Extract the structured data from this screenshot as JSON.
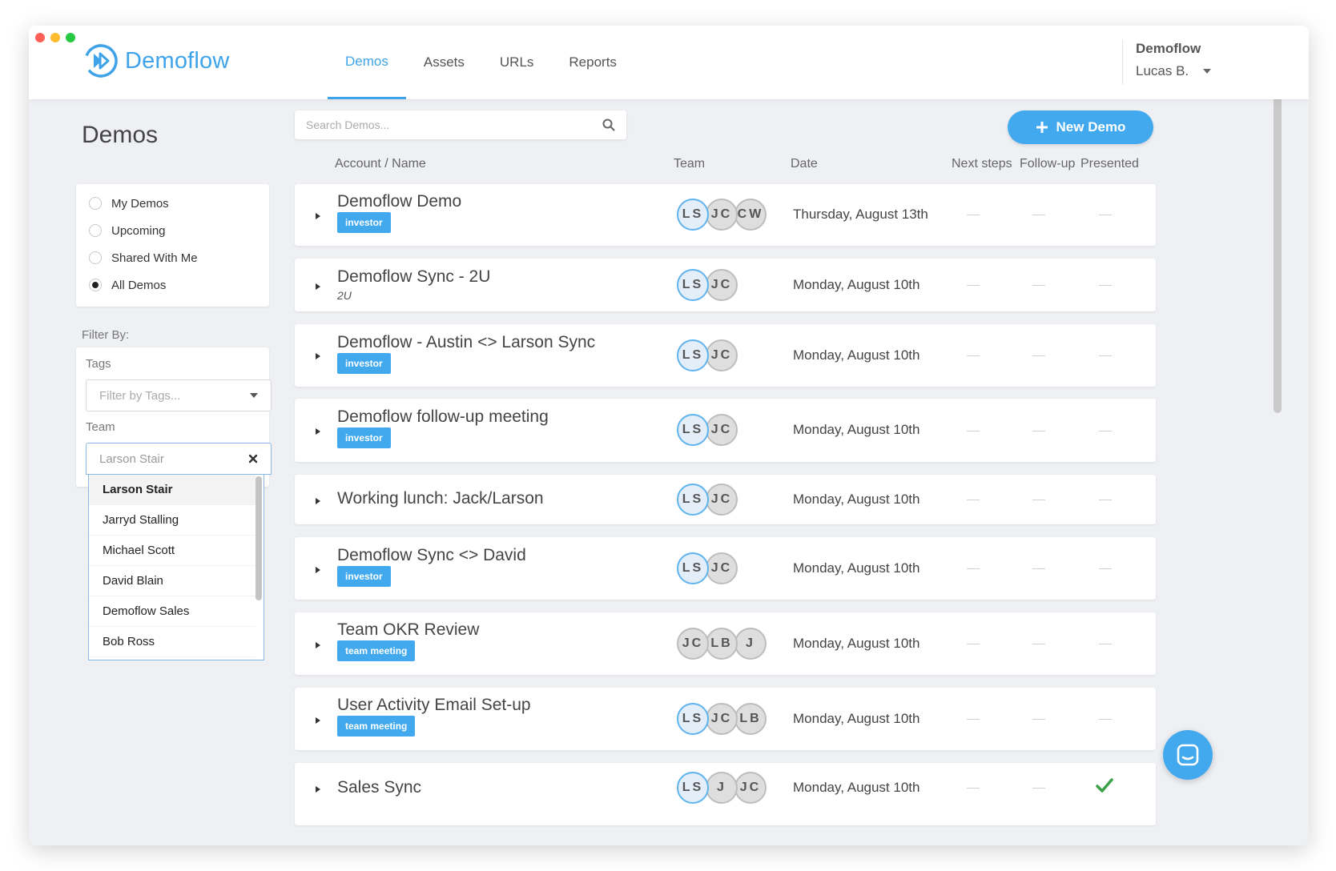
{
  "window": {
    "traffic_colors": [
      "#fe5f57",
      "#febc2e",
      "#28c840"
    ]
  },
  "brand": {
    "name": "Demoflow",
    "color": "#3ea3e8"
  },
  "nav": {
    "items": [
      "Demos",
      "Assets",
      "URLs",
      "Reports"
    ],
    "active": "Demos"
  },
  "account": {
    "org": "Demoflow",
    "user": "Lucas B."
  },
  "page": {
    "title": "Demos"
  },
  "views": {
    "items": [
      {
        "label": "My Demos",
        "checked": false
      },
      {
        "label": "Upcoming",
        "checked": false
      },
      {
        "label": "Shared With Me",
        "checked": false
      },
      {
        "label": "All Demos",
        "checked": true
      }
    ]
  },
  "filters": {
    "heading": "Filter By:",
    "tags_label": "Tags",
    "tags_placeholder": "Filter by Tags...",
    "team_label": "Team",
    "team_value": "Larson Stair",
    "team_options": [
      "Larson Stair",
      "Jarryd Stalling",
      "Michael Scott",
      "David Blain",
      "Demoflow Sales",
      "Bob Ross"
    ],
    "highlighted": "Larson Stair"
  },
  "search": {
    "placeholder": "Search Demos..."
  },
  "actions": {
    "new_demo": "New Demo"
  },
  "table": {
    "headers": [
      "Account / Name",
      "Team",
      "Date",
      "Next steps",
      "Follow-up",
      "Presented"
    ],
    "rows": [
      {
        "name": "Demoflow Demo",
        "tag": "investor",
        "team": [
          "LS",
          "JC",
          "CW"
        ],
        "date": "Thursday, August 13th",
        "next_steps": "—",
        "follow_up": "—",
        "presented": "—"
      },
      {
        "name": "Demoflow Sync - 2U",
        "subtitle": "2U",
        "team": [
          "LS",
          "JC"
        ],
        "date": "Monday, August 10th",
        "next_steps": "—",
        "follow_up": "—",
        "presented": "—"
      },
      {
        "name": "Demoflow - Austin <> Larson Sync",
        "tag": "investor",
        "team": [
          "LS",
          "JC"
        ],
        "date": "Monday, August 10th",
        "next_steps": "—",
        "follow_up": "—",
        "presented": "—"
      },
      {
        "name": "Demoflow follow-up meeting",
        "tag": "investor",
        "team": [
          "LS",
          "JC"
        ],
        "date": "Monday, August 10th",
        "next_steps": "—",
        "follow_up": "—",
        "presented": "—"
      },
      {
        "name": "Working lunch: Jack/Larson",
        "team": [
          "LS",
          "JC"
        ],
        "date": "Monday, August 10th",
        "next_steps": "—",
        "follow_up": "—",
        "presented": "—"
      },
      {
        "name": "Demoflow Sync <> David",
        "tag": "investor",
        "team": [
          "LS",
          "JC"
        ],
        "date": "Monday, August 10th",
        "next_steps": "—",
        "follow_up": "—",
        "presented": "—"
      },
      {
        "name": "Team OKR Review",
        "tag": "team meeting",
        "team": [
          "JC",
          "LB",
          "J"
        ],
        "date": "Monday, August 10th",
        "next_steps": "—",
        "follow_up": "—",
        "presented": "—"
      },
      {
        "name": "User Activity Email Set-up",
        "tag": "team meeting",
        "team": [
          "LS",
          "JC",
          "LB"
        ],
        "date": "Monday, August 10th",
        "next_steps": "—",
        "follow_up": "—",
        "presented": "—"
      },
      {
        "name": "Sales Sync",
        "team": [
          "LS",
          "J",
          "JC"
        ],
        "date": "Monday, August 10th",
        "next_steps": "—",
        "follow_up": "—",
        "presented": "check"
      }
    ]
  },
  "icons": {
    "search": "search-icon",
    "plus": "plus-icon",
    "chat": "chat-icon",
    "check": "check-icon",
    "clear": "clear-icon"
  },
  "colors": {
    "accent": "#42a9ef",
    "check": "#3aa14a"
  }
}
